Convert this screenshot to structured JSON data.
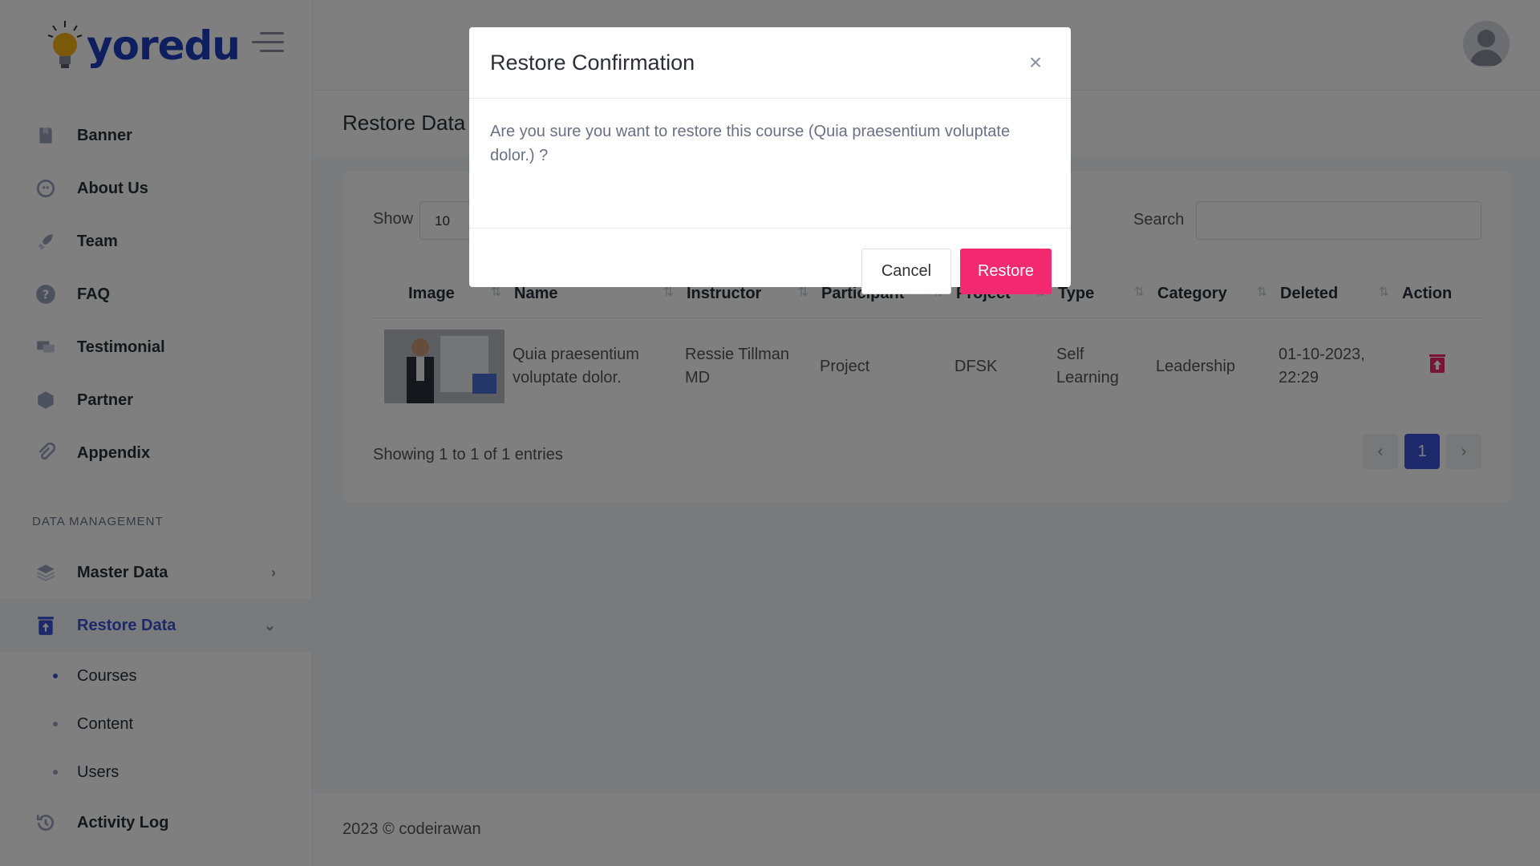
{
  "brand": {
    "name": "yoredu"
  },
  "sidebar": {
    "items": [
      {
        "label": "Banner",
        "icon": "bookmark-icon"
      },
      {
        "label": "About Us",
        "icon": "chat-icon"
      },
      {
        "label": "Team",
        "icon": "rocket-icon"
      },
      {
        "label": "FAQ",
        "icon": "question-icon"
      },
      {
        "label": "Testimonial",
        "icon": "comments-icon"
      },
      {
        "label": "Partner",
        "icon": "shield-icon"
      },
      {
        "label": "Appendix",
        "icon": "paperclip-icon"
      }
    ],
    "section_label": "DATA MANAGEMENT",
    "master_data": "Master Data",
    "restore_data": "Restore Data",
    "restore_sub": [
      "Courses",
      "Content",
      "Users"
    ],
    "activity_log": "Activity Log"
  },
  "page": {
    "title": "Restore Data"
  },
  "table_controls": {
    "show_label": "Show",
    "show_value": "10",
    "search_label": "Search"
  },
  "table": {
    "headers": [
      "Image",
      "Name",
      "Instructor",
      "Participant",
      "Project",
      "Type",
      "Category",
      "Deleted",
      "Action"
    ],
    "rows": [
      {
        "name": "Quia praesentium voluptate dolor.",
        "instructor": "Ressie Tillman MD",
        "participant": "Project",
        "project": "DFSK",
        "type": "Self Learning",
        "category": "Leadership",
        "deleted": "01-10-2023, 22:29"
      }
    ]
  },
  "pagination": {
    "info": "Showing 1 to 1 of 1 entries",
    "current": "1",
    "prev": "‹",
    "next": "›"
  },
  "footer": {
    "text": "2023  © codeirawan"
  },
  "modal": {
    "title": "Restore Confirmation",
    "body": "Are you sure you want to restore this course (Quia praesentium voluptate dolor.) ?",
    "cancel": "Cancel",
    "confirm": "Restore",
    "close": "×"
  },
  "colors": {
    "accent": "#3b53d6",
    "danger": "#f2296e",
    "brand": "#1c3cbc"
  }
}
